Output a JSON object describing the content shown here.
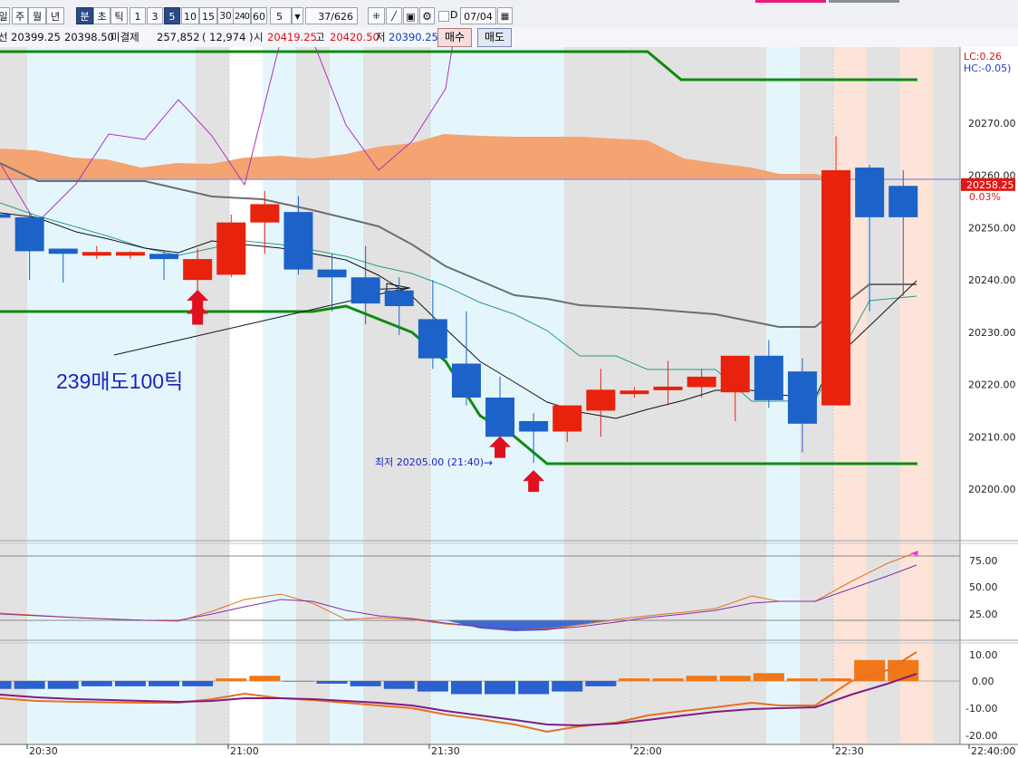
{
  "toolbar": {
    "period_buttons": [
      "일",
      "주",
      "월",
      "년",
      "분",
      "초",
      "틱"
    ],
    "active_period": "분",
    "interval_buttons": [
      "1",
      "3",
      "5",
      "10",
      "15",
      "30",
      "240",
      "60"
    ],
    "active_interval": "5",
    "interval_value": "5",
    "record_counter": "37/626",
    "d_checkbox_label": "D",
    "date_value": "07/04"
  },
  "info_bar": {
    "prev_label": "선",
    "prev_value": "20399.25",
    "current_value": "20398.50",
    "open_interest_label": "미결제",
    "open_interest_value": "257,852",
    "open_interest_change": "( 12,974 )",
    "open_label": "시",
    "open_value": "20419.25",
    "high_label": "고",
    "high_value": "20420.50",
    "low_label": "저",
    "low_value": "20390.25",
    "buy_button": "매수",
    "sell_button": "매도"
  },
  "price_axis": {
    "lc_label": "LC:0.26",
    "hc_label": "HC:-0.05)",
    "ticks": [
      "20270.00",
      "20260.00",
      "20250.00",
      "20240.00",
      "20230.00",
      "20220.00",
      "20210.00",
      "20200.00"
    ],
    "current_price": "20258.25",
    "current_change": "0.03%"
  },
  "stoch_axis": {
    "ticks": [
      "75.00",
      "50.00",
      "25.00"
    ]
  },
  "macd_axis": {
    "ticks": [
      "10.00",
      "0.00",
      "-10.00",
      "-20.00"
    ]
  },
  "time_axis": {
    "ticks": [
      "20:30",
      "21:00",
      "21:30",
      "22:00",
      "22:30",
      "22:40:00"
    ]
  },
  "annotations": {
    "sell_note": "239매도100틱",
    "low_note": "최저 20205.00 (21:40)"
  },
  "colors": {
    "up_candle": "#e8220c",
    "down_candle": "#1c62c8",
    "support_line": "#0f8a0f",
    "cloud": "#f4a470",
    "signal_arrow": "#e01020",
    "pale_band": "#e4f6fc",
    "gray_band": "#e2e2e2",
    "peach_band": "#fde3d8"
  },
  "chart_data": {
    "type": "candlestick",
    "x": [
      "20:25",
      "20:30",
      "20:35",
      "20:40",
      "20:45",
      "20:50",
      "20:55",
      "21:00",
      "21:05",
      "21:10",
      "21:15",
      "21:20",
      "21:25",
      "21:30",
      "21:35",
      "21:40",
      "21:45",
      "21:50",
      "21:55",
      "22:00",
      "22:05",
      "22:10",
      "22:15",
      "22:20",
      "22:25",
      "22:30",
      "22:35",
      "22:40"
    ],
    "series": [
      {
        "open": [
          20252.5,
          20252.0,
          20246.0,
          20245.0,
          20245.0,
          20245.0,
          20240.0,
          20241.0,
          20251.0,
          20253.0,
          20242.0,
          20240.5,
          20238.0,
          20232.5,
          20224.0,
          20217.5,
          20213.0,
          20211.0,
          20215.0,
          20218.5,
          20219.0,
          20219.5,
          20218.5,
          20225.5,
          20222.5,
          20216.0,
          20261.5,
          20258.0
        ],
        "close": [
          20252.0,
          20245.5,
          20245.0,
          20245.0,
          20245.0,
          20244.0,
          20244.0,
          20251.0,
          20254.5,
          20242.0,
          20240.5,
          20235.5,
          20235.0,
          20225.0,
          20217.5,
          20210.0,
          20211.0,
          20216.0,
          20219.0,
          20218.5,
          20219.5,
          20221.5,
          20225.5,
          20217.0,
          20212.5,
          20261.0,
          20252.0,
          20252.0
        ],
        "high": [
          20253.5,
          20253.0,
          20246.0,
          20246.5,
          20245.5,
          20245.5,
          20246.0,
          20252.5,
          20257.0,
          20256.0,
          20245.0,
          20246.5,
          20240.5,
          20240.0,
          20234.0,
          20221.5,
          20214.5,
          20213.0,
          20223.0,
          20219.5,
          20224.5,
          20223.0,
          20220.0,
          20228.5,
          20225.0,
          20267.5,
          20262.0,
          20261.0
        ],
        "low": [
          20243.0,
          20240.0,
          20239.5,
          20244.0,
          20244.0,
          20240.0,
          20237.0,
          20240.5,
          20245.0,
          20241.0,
          20234.0,
          20231.5,
          20229.5,
          20223.0,
          20216.0,
          20211.5,
          20205.0,
          20209.0,
          20210.0,
          20217.5,
          20216.0,
          20217.5,
          20213.0,
          20215.5,
          20207.0,
          20216.0,
          20234.0,
          20237.0
        ]
      }
    ],
    "price_ticks": [
      20270,
      20260,
      20250,
      20240,
      20230,
      20220,
      20210,
      20200
    ],
    "ylim": [
      20194,
      20282
    ],
    "signals_up_index": [
      6,
      15,
      16
    ],
    "support_low_value": 20205.0
  }
}
